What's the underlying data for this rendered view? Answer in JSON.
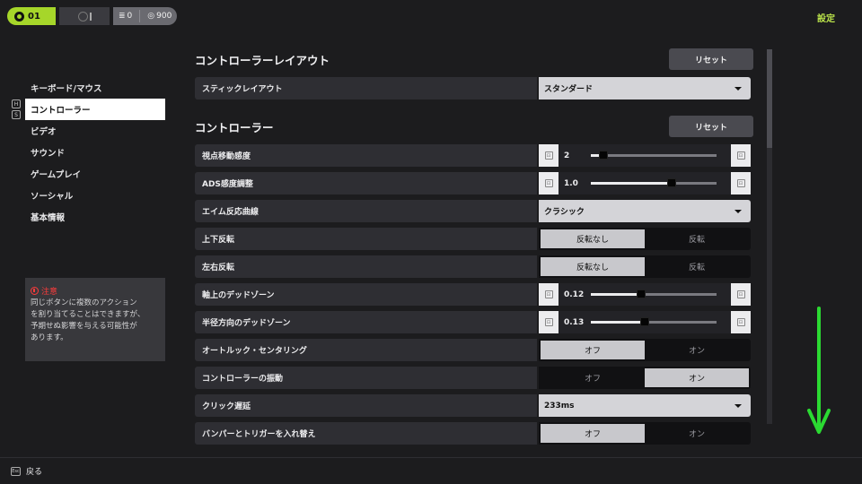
{
  "topbar": {
    "level": "01",
    "currency_a": "0",
    "currency_b": "900",
    "settings_title": "設定"
  },
  "sidebar": {
    "hint_keys": [
      "H",
      "S"
    ],
    "items": [
      {
        "label": "キーボード/マウス",
        "active": false
      },
      {
        "label": "コントローラー",
        "active": true
      },
      {
        "label": "ビデオ",
        "active": false
      },
      {
        "label": "サウンド",
        "active": false
      },
      {
        "label": "ゲームプレイ",
        "active": false
      },
      {
        "label": "ソーシャル",
        "active": false
      },
      {
        "label": "基本情報",
        "active": false
      }
    ]
  },
  "notice": {
    "title": "注意",
    "body": "同じボタンに複数のアクション\nを割り当てることはできますが、\n予期せぬ影響を与える可能性が\nあります。"
  },
  "sections": {
    "layout": {
      "title": "コントローラーレイアウト",
      "reset_label": "リセット",
      "stick_layout": {
        "label": "スティックレイアウト",
        "value": "スタンダード"
      }
    },
    "controller": {
      "title": "コントローラー",
      "reset_label": "リセット",
      "rows": {
        "look_sensitivity": {
          "label": "視点移動感度",
          "value": "2",
          "fraction": 0.1,
          "left_key": "⊡",
          "right_key": "⊡"
        },
        "ads_sensitivity": {
          "label": "ADS感度調整",
          "value": "1.0",
          "fraction": 0.64,
          "left_key": "⊡",
          "right_key": "⊡"
        },
        "aim_curve": {
          "label": "エイム反応曲線",
          "value": "クラシック"
        },
        "invert_vertical": {
          "label": "上下反転",
          "options": [
            "反転なし",
            "反転"
          ],
          "selected": 0
        },
        "invert_horizontal": {
          "label": "左右反転",
          "options": [
            "反転なし",
            "反転"
          ],
          "selected": 0
        },
        "axial_deadzone": {
          "label": "軸上のデッドゾーン",
          "value": "0.12",
          "fraction": 0.4,
          "left_key": "⊡",
          "right_key": "⊡"
        },
        "radial_deadzone": {
          "label": "半径方向のデッドゾーン",
          "value": "0.13",
          "fraction": 0.43,
          "left_key": "⊡",
          "right_key": "⊡"
        },
        "auto_look_centering": {
          "label": "オートルック・センタリング",
          "options": [
            "オフ",
            "オン"
          ],
          "selected": 0
        },
        "vibration": {
          "label": "コントローラーの振動",
          "options": [
            "オフ",
            "オン"
          ],
          "selected": 1
        },
        "click_delay": {
          "label": "クリック遅延",
          "value": "233ms"
        },
        "swap_bumpers_triggers": {
          "label": "バンパーとトリガーを入れ替え",
          "options": [
            "オフ",
            "オン"
          ],
          "selected": 0
        }
      }
    }
  },
  "footer": {
    "back_label": "戻る",
    "esc_key": "Esc"
  },
  "colors": {
    "accent": "#a6d62a",
    "settings_title": "#b9e14a",
    "warning": "#ff3b3b",
    "scroll_arrow": "#2bd932"
  }
}
